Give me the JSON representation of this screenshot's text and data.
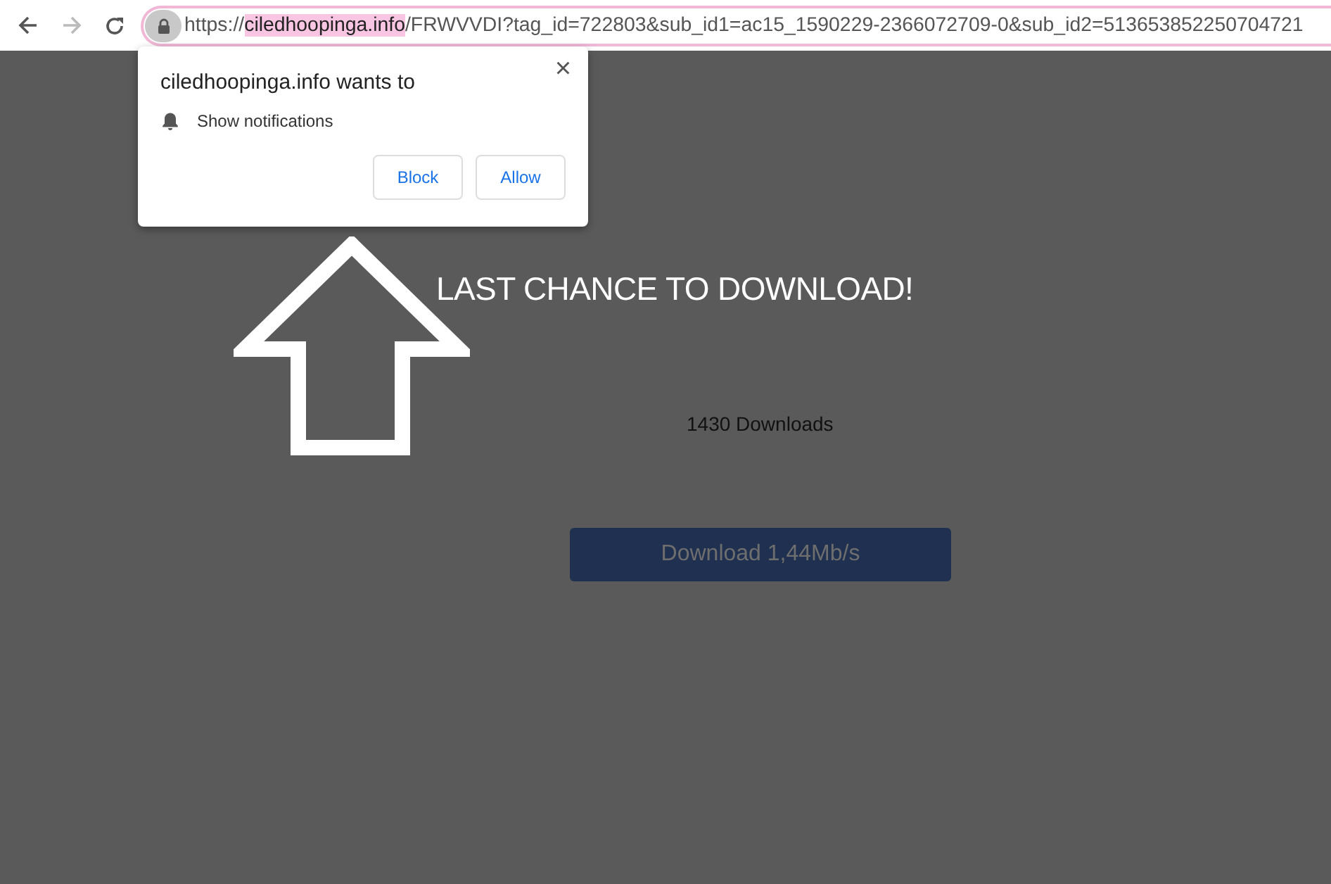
{
  "address_bar": {
    "scheme": "https://",
    "host": "ciledhoopinga.info",
    "path": "/FRWVVDI?tag_id=722803&sub_id1=ac15_1590229-2366072709-0&sub_id2=513653852250704721"
  },
  "permission_popup": {
    "title": "ciledhoopinga.info wants to",
    "permission": "Show notifications",
    "close": "×",
    "buttons": [
      "Block",
      "Allow"
    ]
  },
  "page": {
    "headline": "LAST CHANCE TO DOWNLOAD!",
    "downloads": "1430 Downloads",
    "download_button": "Download 1,44Mb/s"
  }
}
